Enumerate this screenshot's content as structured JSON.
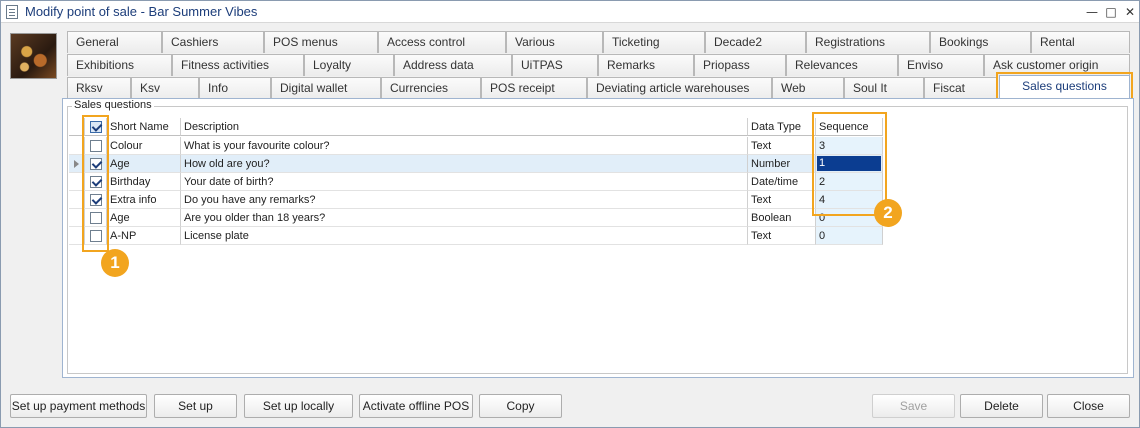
{
  "window": {
    "title": "Modify point of sale - Bar Summer Vibes"
  },
  "tabs": {
    "row1": [
      "General",
      "Cashiers",
      "POS menus",
      "Access control",
      "Various",
      "Ticketing",
      "Decade2",
      "Registrations",
      "Bookings",
      "Rental"
    ],
    "row2": [
      "Exhibitions",
      "Fitness activities",
      "Loyalty",
      "Address data",
      "UiTPAS",
      "Remarks",
      "Priopass",
      "Relevances",
      "Enviso",
      "Ask customer origin"
    ],
    "row3": [
      "Rksv",
      "Ksv",
      "Info",
      "Digital wallet",
      "Currencies",
      "POS receipt",
      "Deviating article warehouses",
      "Web",
      "Soul It",
      "Fiscat",
      "Sales questions"
    ],
    "active": "Sales questions"
  },
  "group": {
    "label": "Sales questions"
  },
  "grid": {
    "headers": {
      "short_name": "Short Name",
      "description": "Description",
      "data_type": "Data Type",
      "sequence": "Sequence"
    },
    "header_checked": true,
    "rows": [
      {
        "checked": false,
        "short_name": "Colour",
        "description": "What is your favourite colour?",
        "data_type": "Text",
        "sequence": "3"
      },
      {
        "checked": true,
        "short_name": "Age",
        "description": "How old are you?",
        "data_type": "Number",
        "sequence": "1",
        "selected": true
      },
      {
        "checked": true,
        "short_name": "Birthday",
        "description": "Your date of birth?",
        "data_type": "Date/time",
        "sequence": "2"
      },
      {
        "checked": true,
        "short_name": "Extra info",
        "description": "Do you have any remarks?",
        "data_type": "Text",
        "sequence": "4"
      },
      {
        "checked": false,
        "short_name": "Age",
        "description": "Are you older than 18 years?",
        "data_type": "Boolean",
        "sequence": "0"
      },
      {
        "checked": false,
        "short_name": "A-NP",
        "description": "License plate",
        "data_type": "Text",
        "sequence": "0"
      }
    ]
  },
  "callouts": {
    "one": "1",
    "two": "2"
  },
  "colors": {
    "highlight": "#f2a51f",
    "selection": "#0b3d91"
  },
  "buttons": {
    "setup_payment": "Set up payment methods",
    "setup": "Set up",
    "setup_locally": "Set up locally",
    "activate_offline": "Activate offline POS",
    "copy": "Copy",
    "save": "Save",
    "delete": "Delete",
    "close": "Close"
  }
}
